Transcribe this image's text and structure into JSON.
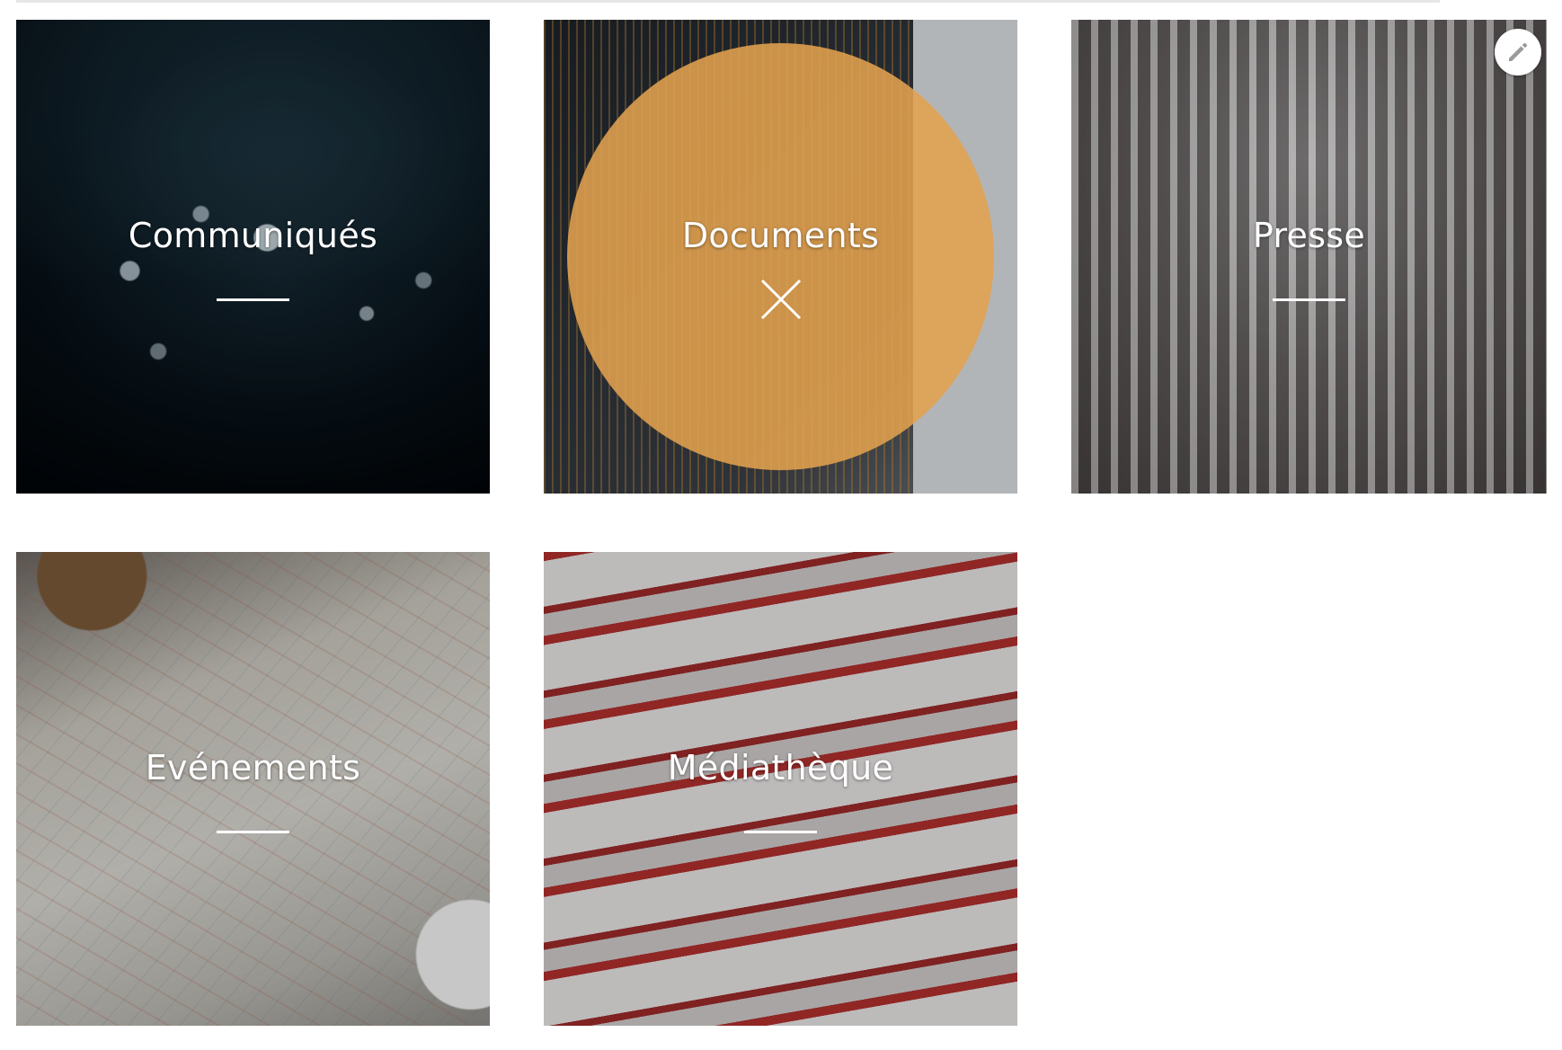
{
  "tiles": [
    {
      "label": "Communiqués",
      "theme": "water-drops-photo"
    },
    {
      "label": "Documents",
      "theme": "trading-chart-photo",
      "hover": true,
      "accent": "#E2A24F"
    },
    {
      "label": "Presse",
      "theme": "typewriter-photo",
      "editable": true
    },
    {
      "label": "Evénements",
      "theme": "map-photo"
    },
    {
      "label": "Médiathèque",
      "theme": "red-books-photo"
    }
  ],
  "colors": {
    "hover_overlay": "#E2A24F",
    "text": "#FFFFFF",
    "background": "#FFFFFF"
  },
  "icons": {
    "close": "close-icon",
    "edit": "pencil-icon"
  }
}
